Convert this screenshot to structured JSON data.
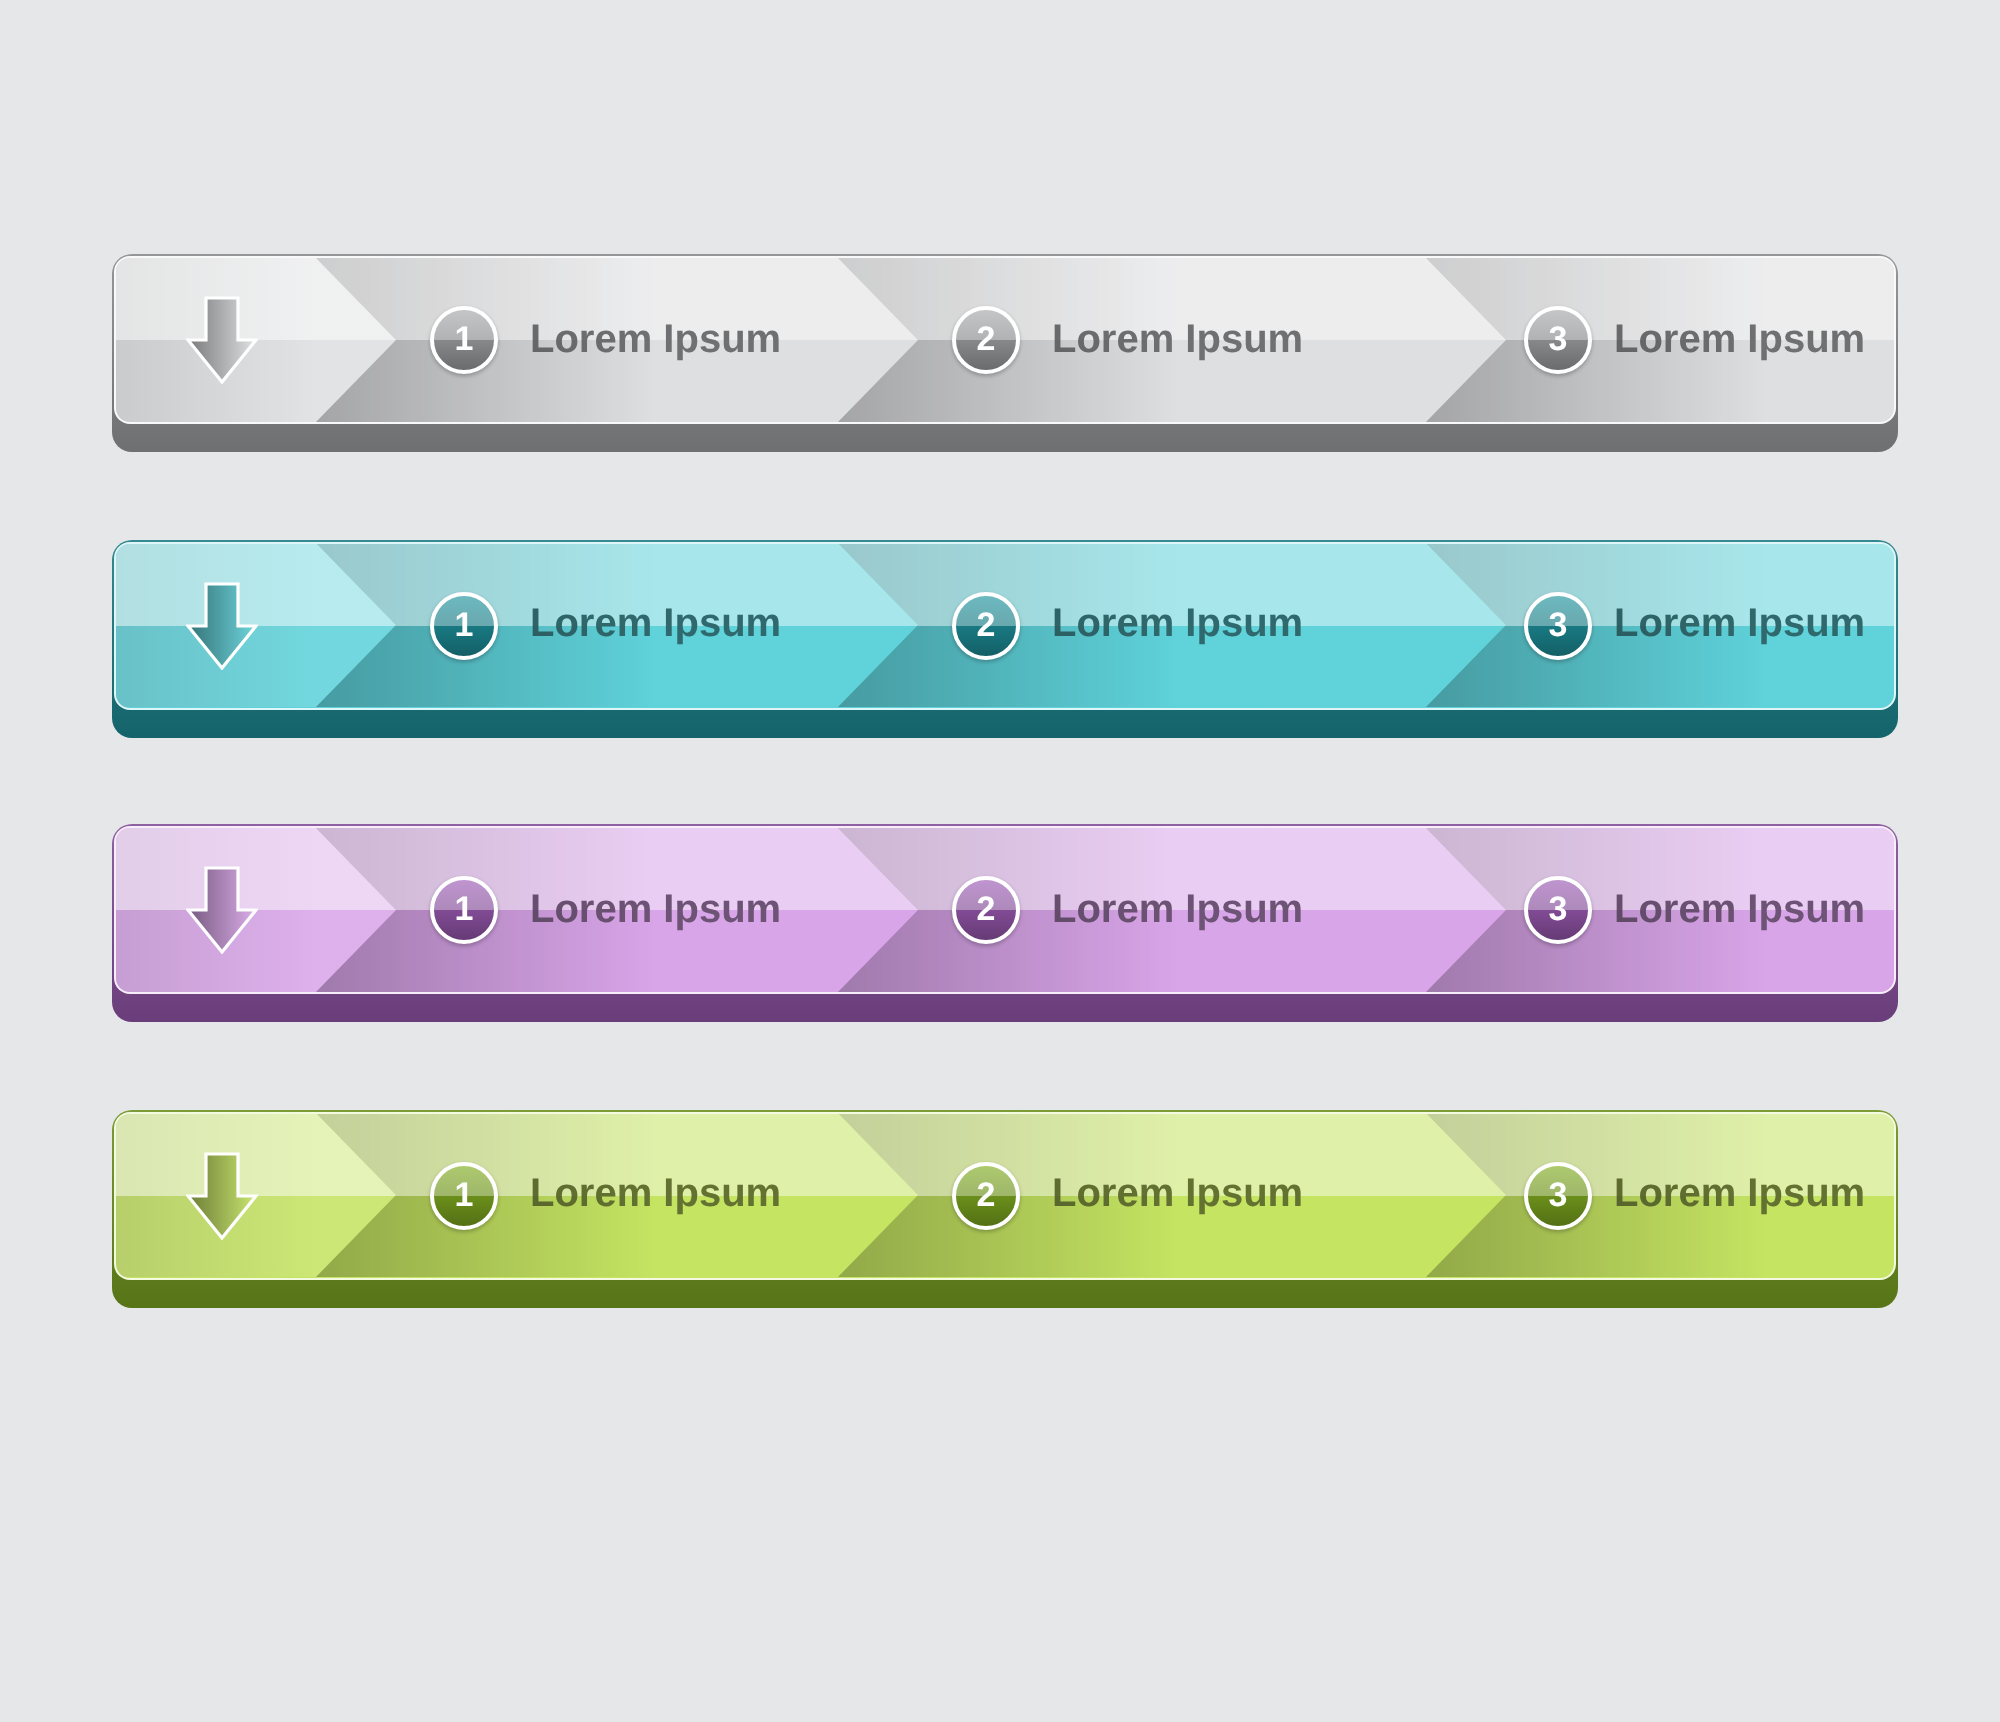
{
  "bars": [
    {
      "color": "#dedfe1",
      "steps": [
        {
          "number": "1",
          "label": "Lorem Ipsum"
        },
        {
          "number": "2",
          "label": "Lorem Ipsum"
        },
        {
          "number": "3",
          "label": "Lorem Ipsum"
        }
      ]
    },
    {
      "color": "#5fd2da",
      "steps": [
        {
          "number": "1",
          "label": "Lorem Ipsum"
        },
        {
          "number": "2",
          "label": "Lorem Ipsum"
        },
        {
          "number": "3",
          "label": "Lorem Ipsum"
        }
      ]
    },
    {
      "color": "#d9a5e9",
      "steps": [
        {
          "number": "1",
          "label": "Lorem Ipsum"
        },
        {
          "number": "2",
          "label": "Lorem Ipsum"
        },
        {
          "number": "3",
          "label": "Lorem Ipsum"
        }
      ]
    },
    {
      "color": "#c5e462",
      "steps": [
        {
          "number": "1",
          "label": "Lorem Ipsum"
        },
        {
          "number": "2",
          "label": "Lorem Ipsum"
        },
        {
          "number": "3",
          "label": "Lorem Ipsum"
        }
      ]
    }
  ]
}
